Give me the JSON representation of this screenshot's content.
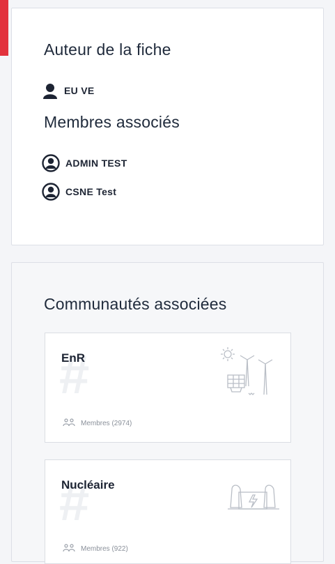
{
  "author_section": {
    "title": "Auteur de la fiche",
    "author": {
      "name": "EU VE",
      "icon": "user-icon"
    }
  },
  "members_section": {
    "title": "Membres associés",
    "members": [
      {
        "name": "ADMIN TEST",
        "icon": "user-circle-icon"
      },
      {
        "name": "CSNE Test",
        "icon": "user-circle-icon"
      }
    ]
  },
  "communities_section": {
    "title": "Communautés associées",
    "communities": [
      {
        "name": "EnR",
        "members_label": "Membres (2974)",
        "illustration": "renewable-energy-icon"
      },
      {
        "name": "Nucléaire",
        "members_label": "Membres (922)",
        "illustration": "nuclear-plant-icon"
      }
    ]
  },
  "colors": {
    "accent": "#e2323d",
    "text": "#1d2433",
    "muted": "#8a909a"
  }
}
